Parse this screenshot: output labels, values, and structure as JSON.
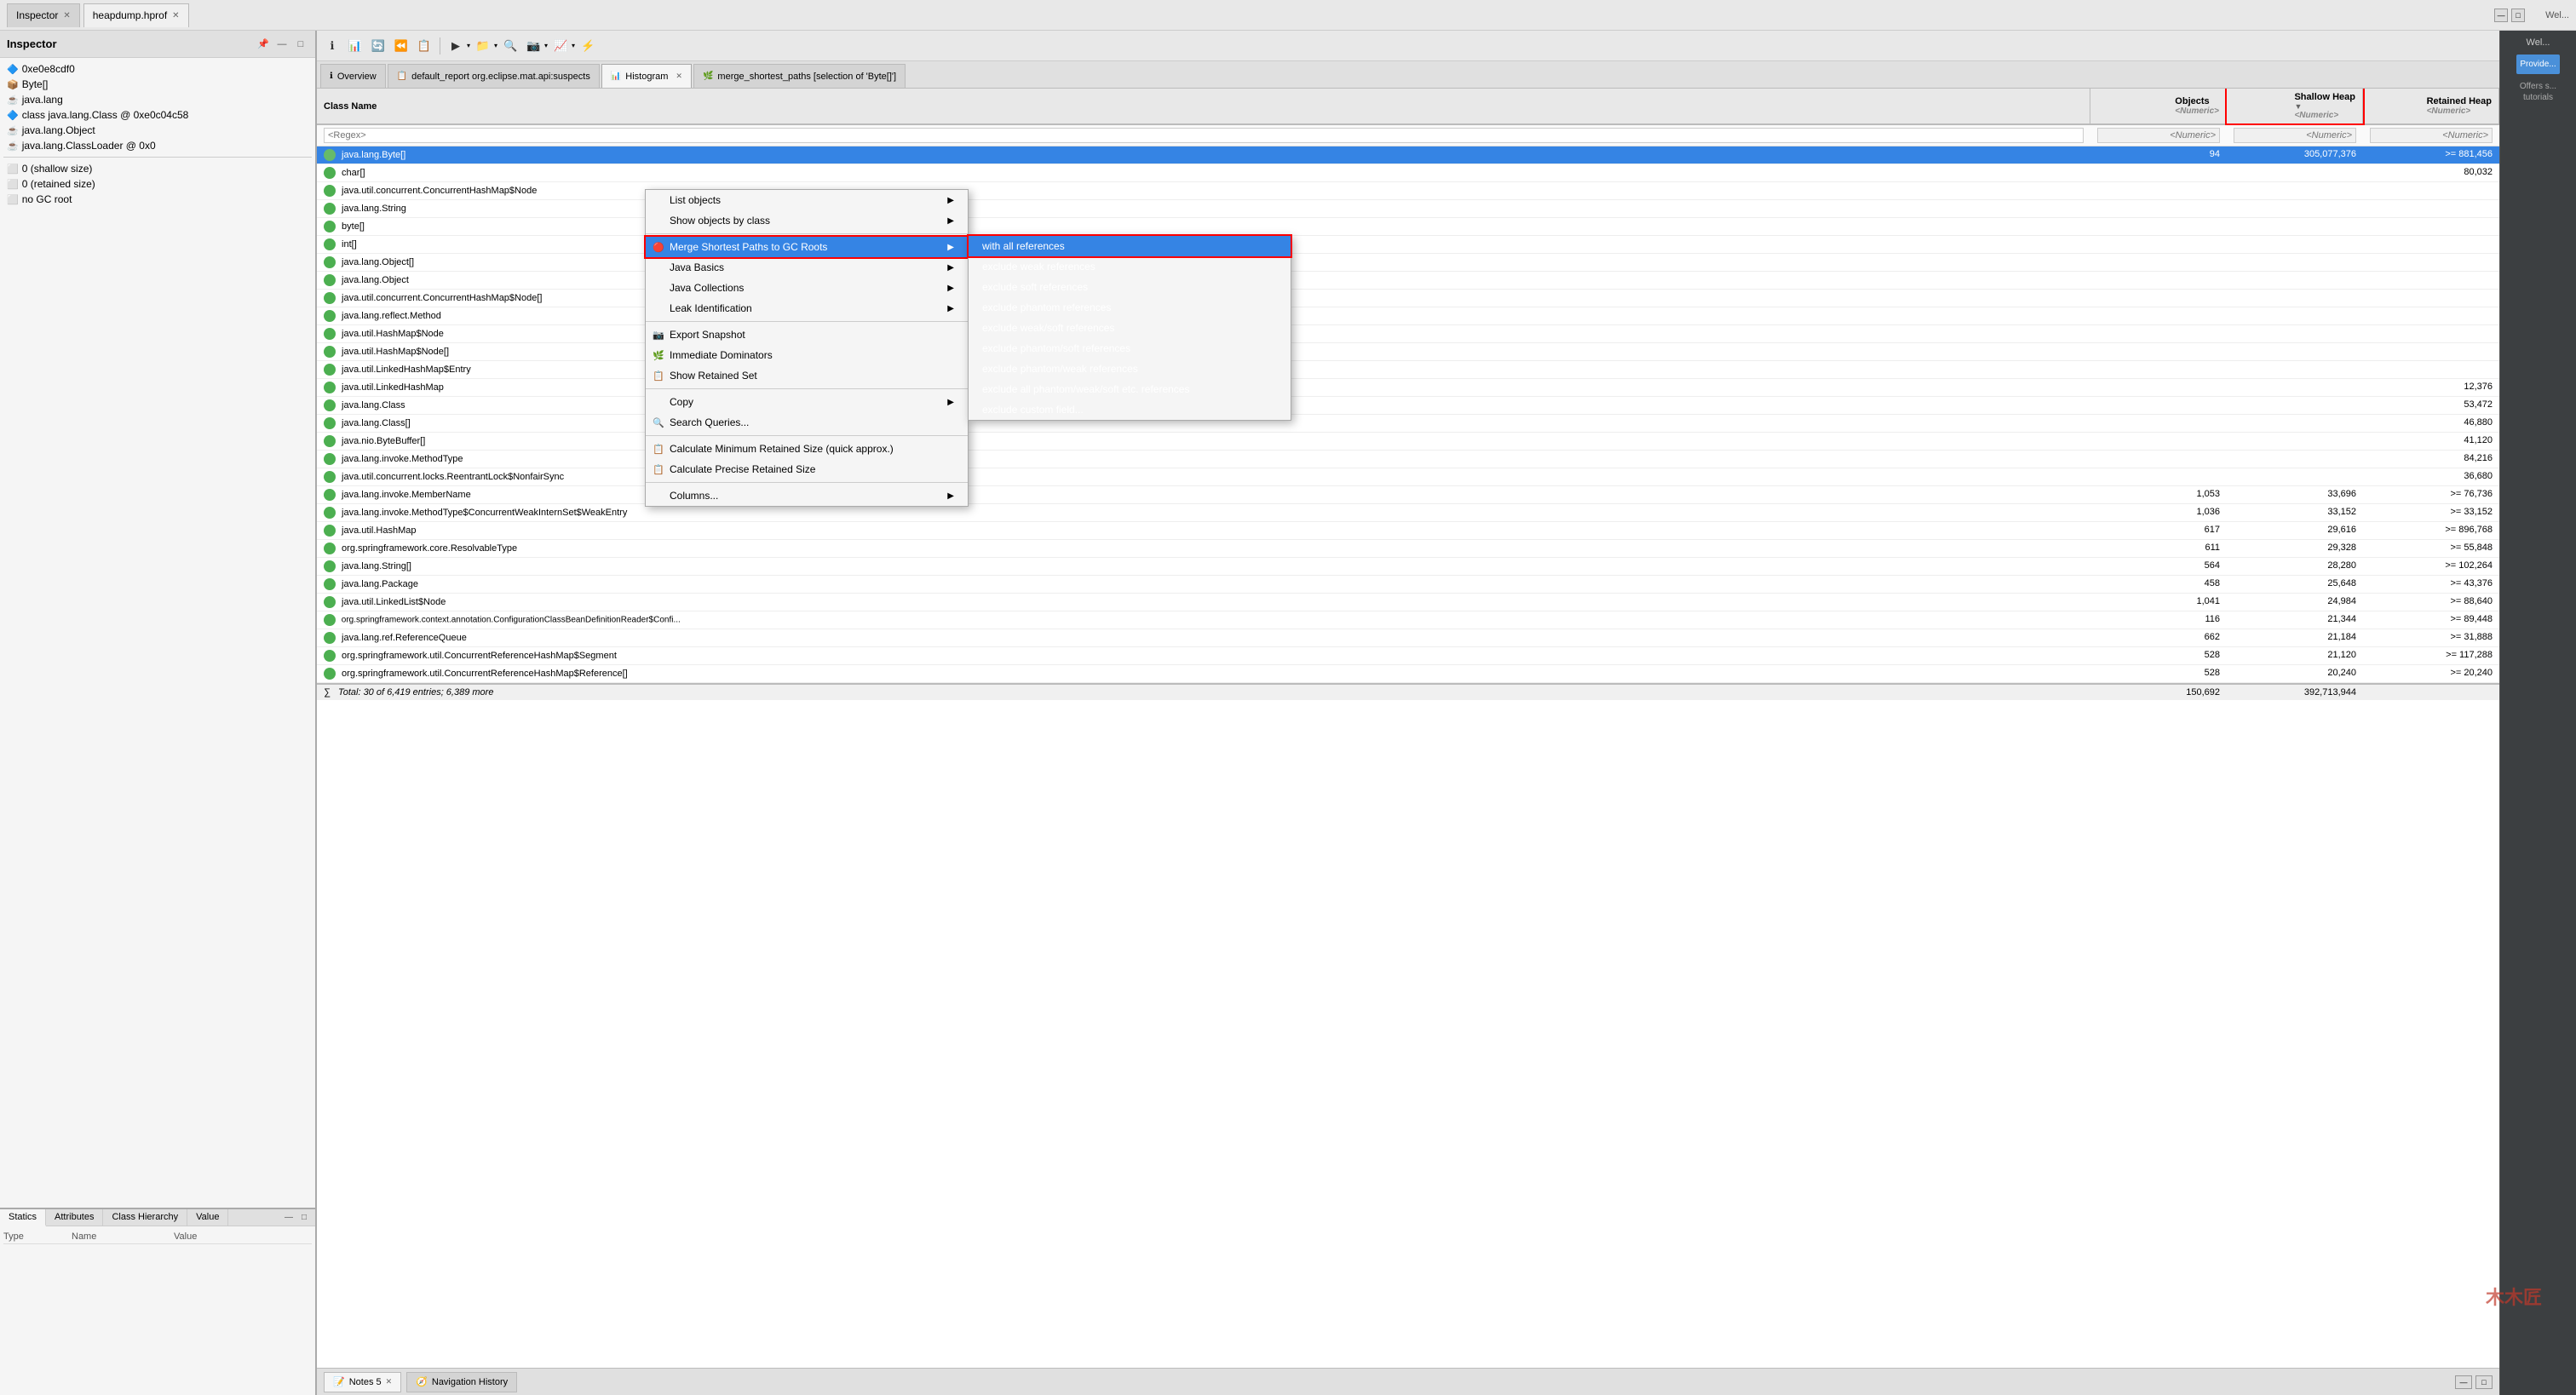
{
  "app": {
    "title": "Inspector",
    "heap_tab": "heapdump.hprof",
    "close_symbol": "✕",
    "pin_icon": "📌",
    "minimize_icon": "—",
    "maximize_icon": "□"
  },
  "inspector": {
    "title": "Inspector",
    "items": [
      {
        "id": "address",
        "icon": "🔷",
        "label": "0xe0e8cdf0"
      },
      {
        "id": "byte_array",
        "icon": "📦",
        "label": "Byte[]"
      },
      {
        "id": "java_lang",
        "icon": "☕",
        "label": "java.lang"
      },
      {
        "id": "class_java",
        "icon": "🔷",
        "label": "class java.lang.Class @ 0xe0c04c58"
      },
      {
        "id": "java_lang_object",
        "icon": "☕",
        "label": "java.lang.Object"
      },
      {
        "id": "classloader",
        "icon": "☕",
        "label": "java.lang.ClassLoader @ 0x0"
      }
    ],
    "labels": [
      {
        "text": "0 (shallow size)"
      },
      {
        "text": "0 (retained size)"
      },
      {
        "text": "no GC root"
      }
    ],
    "tabs": [
      "Statics",
      "Attributes",
      "Class Hierarchy",
      "Value"
    ],
    "active_tab": "Statics",
    "tab_columns": [
      "Type",
      "Name",
      "Value"
    ]
  },
  "toolbar": {
    "buttons": [
      "ℹ",
      "📊",
      "🔄",
      "⏪",
      "📋",
      "▶",
      "📁",
      "🔍",
      "📷",
      "📈",
      "⚡"
    ],
    "overview_label": "Overview"
  },
  "tabs": [
    {
      "id": "overview",
      "label": "Overview",
      "icon": "ℹ",
      "closable": false
    },
    {
      "id": "default_report",
      "label": "default_report  org.eclipse.mat.api:suspects",
      "icon": "📋",
      "closable": false
    },
    {
      "id": "histogram",
      "label": "Histogram",
      "icon": "📊",
      "closable": true,
      "active": true
    },
    {
      "id": "merge_shortest",
      "label": "merge_shortest_paths  [selection of 'Byte[]']",
      "icon": "🌿",
      "closable": false
    }
  ],
  "histogram": {
    "columns": {
      "class_name": "Class Name",
      "objects": "Objects",
      "shallow_heap": "Shallow Heap",
      "retained_heap": "Retained Heap",
      "numeric_label": "<Numeric>",
      "objects_label": ""
    },
    "filter_row": {
      "class_placeholder": "<Regex>",
      "numeric_placeholder": "<Numeric>"
    },
    "rows": [
      {
        "icon": "circle",
        "name": "java.lang.Byte[]",
        "objects": "94",
        "shallow": "305,077,376",
        "retained": ">= 881,456",
        "selected": true
      },
      {
        "icon": "circle",
        "name": "char[]",
        "objects": "",
        "shallow": "",
        "retained": "80,032",
        "selected": false
      },
      {
        "icon": "circle",
        "name": "java.util.concurrent.ConcurrentHashMap$Node",
        "objects": "",
        "shallow": "",
        "retained": "",
        "selected": false
      },
      {
        "icon": "circle",
        "name": "java.lang.String",
        "objects": "",
        "shallow": "",
        "retained": "",
        "selected": false
      },
      {
        "icon": "circle",
        "name": "byte[]",
        "objects": "",
        "shallow": "",
        "retained": "",
        "selected": false
      },
      {
        "icon": "circle",
        "name": "int[]",
        "objects": "",
        "shallow": "",
        "retained": "",
        "selected": false
      },
      {
        "icon": "circle",
        "name": "java.lang.Object[]",
        "objects": "",
        "shallow": "",
        "retained": "",
        "selected": false
      },
      {
        "icon": "circle",
        "name": "java.lang.Object",
        "objects": "",
        "shallow": "",
        "retained": "",
        "selected": false
      },
      {
        "icon": "circle",
        "name": "java.util.concurrent.ConcurrentHashMap$Node[]",
        "objects": "",
        "shallow": "",
        "retained": "",
        "selected": false
      },
      {
        "icon": "circle",
        "name": "java.lang.reflect.Method",
        "objects": "",
        "shallow": "",
        "retained": "",
        "selected": false
      },
      {
        "icon": "circle",
        "name": "java.util.HashMap$Node",
        "objects": "",
        "shallow": "",
        "retained": "",
        "selected": false
      },
      {
        "icon": "circle",
        "name": "java.util.HashMap$Node[]",
        "objects": "",
        "shallow": "",
        "retained": "",
        "selected": false
      },
      {
        "icon": "circle",
        "name": "java.util.LinkedHashMap$Entry",
        "objects": "",
        "shallow": "",
        "retained": "",
        "selected": false
      },
      {
        "icon": "circle",
        "name": "java.util.LinkedHashMap",
        "objects": "",
        "shallow": "",
        "retained": "12,376",
        "selected": false
      },
      {
        "icon": "circle",
        "name": "java.lang.Class",
        "objects": "",
        "shallow": "",
        "retained": "53,472",
        "selected": false
      },
      {
        "icon": "circle",
        "name": "java.lang.Class[]",
        "objects": "",
        "shallow": "",
        "retained": "46,880",
        "selected": false
      },
      {
        "icon": "circle",
        "name": "java.nio.ByteBuffer[]",
        "objects": "",
        "shallow": "",
        "retained": "41,120",
        "selected": false
      },
      {
        "icon": "circle",
        "name": "java.lang.invoke.MethodType",
        "objects": "",
        "shallow": "",
        "retained": "84,216",
        "selected": false
      },
      {
        "icon": "circle",
        "name": "java.util.concurrent.locks.ReentrantLock$NonfairSync",
        "objects": "",
        "shallow": "",
        "retained": "36,680",
        "selected": false
      },
      {
        "icon": "circle",
        "name": "java.lang.invoke.MemberName",
        "objects": "1,053",
        "shallow": "33,696",
        "retained": ">= 76,736",
        "selected": false
      },
      {
        "icon": "circle",
        "name": "java.lang.invoke.MethodType$ConcurrentWeakInternSet$WeakEntry",
        "objects": "1,036",
        "shallow": "33,152",
        "retained": ">= 33,152",
        "selected": false
      },
      {
        "icon": "circle",
        "name": "java.util.HashMap",
        "objects": "617",
        "shallow": "29,616",
        "retained": ">= 896,768",
        "selected": false
      },
      {
        "icon": "circle",
        "name": "org.springframework.core.ResolvableType",
        "objects": "611",
        "shallow": "29,328",
        "retained": ">= 55,848",
        "selected": false
      },
      {
        "icon": "circle",
        "name": "java.lang.String[]",
        "objects": "564",
        "shallow": "28,280",
        "retained": ">= 102,264",
        "selected": false
      },
      {
        "icon": "circle",
        "name": "java.lang.Package",
        "objects": "458",
        "shallow": "25,648",
        "retained": ">= 43,376",
        "selected": false
      },
      {
        "icon": "circle",
        "name": "java.util.LinkedList$Node",
        "objects": "1,041",
        "shallow": "24,984",
        "retained": ">= 88,640",
        "selected": false
      },
      {
        "icon": "circle",
        "name": "org.springframework.context.annotation.ConfigurationClassBeanDefinitionReader$Confi...",
        "objects": "116",
        "shallow": "21,344",
        "retained": ">= 89,448",
        "selected": false
      },
      {
        "icon": "circle",
        "name": "java.lang.ref.ReferenceQueue",
        "objects": "662",
        "shallow": "21,184",
        "retained": ">= 31,888",
        "selected": false
      },
      {
        "icon": "circle",
        "name": "org.springframework.util.ConcurrentReferenceHashMap$Segment",
        "objects": "528",
        "shallow": "21,120",
        "retained": ">= 117,288",
        "selected": false
      },
      {
        "icon": "circle",
        "name": "org.springframework.util.ConcurrentReferenceHashMap$Reference[]",
        "objects": "528",
        "shallow": "20,240",
        "retained": ">= 20,240",
        "selected": false
      }
    ],
    "total_row": {
      "label": "∑  Total: 30 of 6,419 entries; 6,389 more",
      "objects": "150,692",
      "shallow": "392,713,944",
      "retained": ""
    }
  },
  "context_menu": {
    "items": [
      {
        "id": "list_objects",
        "label": "List objects",
        "has_arrow": true
      },
      {
        "id": "show_objects_by_class",
        "label": "Show objects by class",
        "has_arrow": true
      },
      {
        "id": "separator1",
        "type": "separator"
      },
      {
        "id": "merge_shortest_paths",
        "label": "Merge Shortest Paths to GC Roots",
        "has_arrow": true,
        "highlighted": true,
        "icon": "🔴"
      },
      {
        "id": "java_basics",
        "label": "Java Basics",
        "has_arrow": true
      },
      {
        "id": "java_collections",
        "label": "Java Collections",
        "has_arrow": true
      },
      {
        "id": "leak_identification",
        "label": "Leak Identification",
        "has_arrow": true
      },
      {
        "id": "separator2",
        "type": "separator"
      },
      {
        "id": "export_snapshot",
        "label": "Export Snapshot",
        "icon": "📷"
      },
      {
        "id": "immediate_dominators",
        "label": "Immediate Dominators",
        "icon": "🌿"
      },
      {
        "id": "show_retained_set",
        "label": "Show Retained Set",
        "icon": "📋"
      },
      {
        "id": "separator3",
        "type": "separator"
      },
      {
        "id": "copy",
        "label": "Copy",
        "has_arrow": true
      },
      {
        "id": "search_queries",
        "label": "Search Queries...",
        "icon": "🔍"
      },
      {
        "id": "separator4",
        "type": "separator"
      },
      {
        "id": "calc_min",
        "label": "Calculate Minimum Retained Size (quick approx.)",
        "icon": "📋"
      },
      {
        "id": "calc_precise",
        "label": "Calculate Precise Retained Size",
        "icon": "📋"
      },
      {
        "id": "separator5",
        "type": "separator"
      },
      {
        "id": "columns",
        "label": "Columns...",
        "has_arrow": true
      }
    ],
    "submenu": {
      "items": [
        {
          "id": "with_all_references",
          "label": "with all references",
          "highlighted": true
        },
        {
          "id": "exclude_weak",
          "label": "exclude weak references"
        },
        {
          "id": "exclude_soft",
          "label": "exclude soft references"
        },
        {
          "id": "exclude_phantom",
          "label": "exclude phantom references"
        },
        {
          "id": "exclude_weak_soft",
          "label": "exclude weak/soft references"
        },
        {
          "id": "exclude_phantom_soft",
          "label": "exclude phantom/soft references"
        },
        {
          "id": "exclude_phantom_weak",
          "label": "exclude phantom/weak references"
        },
        {
          "id": "exclude_all_phantom",
          "label": "exclude all phantom/weak/soft etc. references"
        },
        {
          "id": "exclude_custom",
          "label": "exclude custom field..."
        }
      ]
    }
  },
  "bottom_bar": {
    "tabs": [
      {
        "id": "notes",
        "icon": "📝",
        "label": "Notes 5",
        "closable": true,
        "active": true
      },
      {
        "id": "nav_history",
        "icon": "🧭",
        "label": "Navigation History",
        "closable": false
      }
    ]
  },
  "right_panel": {
    "title": "Wel...",
    "overview_btn": "Provide...",
    "tutorials_btn": "Offers s... tutorials"
  },
  "watermark": "木木匠"
}
